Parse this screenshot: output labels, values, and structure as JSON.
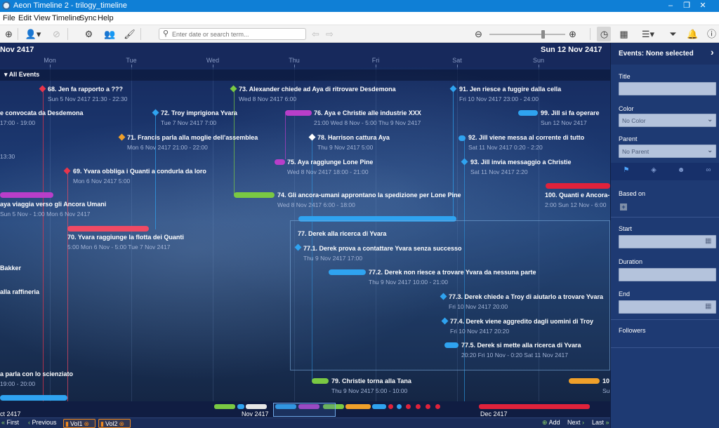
{
  "window": {
    "title": "Aeon Timeline 2 - trilogy_timeline",
    "controls": [
      "–",
      "❐",
      "✕"
    ]
  },
  "menu": [
    "File",
    "Edit",
    "View",
    "Timeline",
    "Sync",
    "Help"
  ],
  "search": {
    "placeholder": "Enter date or search term..."
  },
  "timeline": {
    "date_left": "Nov 2417",
    "date_right": "Sun 12 Nov 2417",
    "days": [
      "Mon",
      "Tue",
      "Wed",
      "Thu",
      "Fri",
      "Sat",
      "Sun"
    ],
    "all_events_label": "All Events",
    "events": [
      {
        "title": "68. Jen fa rapporto a ???",
        "date": "Sun 5 Nov 2417 21:30 - 22:30",
        "color": "#e8354b"
      },
      {
        "title": "e convocata da Desdemona",
        "date": "17:00 - 19:00",
        "color": "#d33aa3"
      },
      {
        "title": "13:30",
        "date": "",
        "color": "#ffffff"
      },
      {
        "title": "69. Yvara obbliga i Quanti a condurla da loro",
        "date": "Mon 6 Nov 2417 5:00",
        "color": "#e8354b"
      },
      {
        "title": "aya viaggia verso gli Ancora Umani",
        "date": "Sun 5 Nov - 1:00 Mon 6 Nov 2417",
        "color": "#b83ec9"
      },
      {
        "title": "70. Yvara raggiunge la flotta dei Quanti",
        "date": "5:00 Mon 6 Nov - 5:00 Tue 7 Nov 2417",
        "color": "#f04a64"
      },
      {
        "title": "Bakker",
        "date": "",
        "color": "#ffffff"
      },
      {
        "title": "alla raffineria",
        "date": "",
        "color": "#ffffff"
      },
      {
        "title": "a parla con lo scienziato",
        "date": "19:00 - 20:00",
        "color": "#ffffff"
      },
      {
        "title": "71. Francis parla alla moglie dell'assemblea",
        "date": "Mon 6 Nov 2417 21:00 - 22:00",
        "color": "#f0a02a"
      },
      {
        "title": "72. Troy imprigiona Yvara",
        "date": "Tue 7 Nov 2417 7:00",
        "color": "#2fa3f0"
      },
      {
        "title": "73. Alexander chiede ad Aya di ritrovare Desdemona",
        "date": "Wed 8 Nov 2417 6:00",
        "color": "#7ac943"
      },
      {
        "title": "74. Gli ancora-umani approntano la spedizione per Lone Pine",
        "date": "Wed 8 Nov 2417 6:00 - 18:00",
        "color": "#7ac943"
      },
      {
        "title": "75. Aya raggiunge Lone Pine",
        "date": "Wed 8 Nov 2417 18:00 - 21:00",
        "color": "#b83ec9"
      },
      {
        "title": "76. Aya e Christie alle industrie XXX",
        "date": "21:00 Wed 8 Nov - 5:00 Thu 9 Nov 2417",
        "color": "#b83ec9"
      },
      {
        "title": "78. Harrison cattura Aya",
        "date": "Thu 9 Nov 2417 5:00",
        "color": "#ffffff"
      },
      {
        "title": "77. Derek alla ricerca di Yvara",
        "date": "",
        "color": "#2fa3f0"
      },
      {
        "title": "77.1. Derek prova a contattare Yvara senza successo",
        "date": "Thu 9 Nov 2417 17:00",
        "color": "#2fa3f0"
      },
      {
        "title": "77.2. Derek non riesce a trovare Yvara da nessuna parte",
        "date": "Thu 9 Nov 2417 10:00 - 21:00",
        "color": "#2fa3f0"
      },
      {
        "title": "77.3. Derek chiede a Troy di aiutarlo a trovare Yvara",
        "date": "Fri 10 Nov 2417 20:00",
        "color": "#2fa3f0"
      },
      {
        "title": "77.4. Derek viene aggredito dagli uomini di Troy",
        "date": "Fri 10 Nov 2417 20:20",
        "color": "#2fa3f0"
      },
      {
        "title": "77.5. Derek si mette alla ricerca di Yvara",
        "date": "20:20 Fri 10 Nov - 0:20 Sat 11 Nov 2417",
        "color": "#2fa3f0"
      },
      {
        "title": "79. Christie torna alla Tana",
        "date": "Thu 9 Nov 2417 5:00 - 10:00",
        "color": "#7ac943"
      },
      {
        "title": "91. Jen riesce a fuggire dalla cella",
        "date": "Fri 10 Nov 2417 23:00 - 24:00",
        "color": "#2fa3f0"
      },
      {
        "title": "92. Jill viene messa al corrente di tutto",
        "date": "Sat 11 Nov 2417 0:20 - 2:20",
        "color": "#2fa3f0"
      },
      {
        "title": "93. Jill invia messaggio a Christie",
        "date": "Sat 11 Nov 2417 2:20",
        "color": "#2fa3f0"
      },
      {
        "title": "99. Jill si fa operare",
        "date": "Sun 12 Nov 2417",
        "color": "#2fa3f0"
      },
      {
        "title": "100. Quanti e Ancora-",
        "date": "2:00 Sun 12 Nov - 6:00",
        "color": "#e0223b"
      },
      {
        "title": "10",
        "date": "Su",
        "color": "#f0a02a"
      }
    ],
    "overview_labels": [
      "ct 2417",
      "Nov 2417",
      "Dec 2417"
    ]
  },
  "navbar": {
    "first": "First",
    "previous": "Previous",
    "tabs": [
      "Vol1",
      "Vol2"
    ],
    "add": "Add",
    "next": "Next",
    "last": "Last"
  },
  "sidepanel": {
    "header": "Events: None selected",
    "title_label": "Title",
    "color_label": "Color",
    "color_value": "No Color",
    "parent_label": "Parent",
    "parent_value": "No Parent",
    "based_on_label": "Based on",
    "start_label": "Start",
    "duration_label": "Duration",
    "end_label": "End",
    "followers_label": "Followers",
    "tab_icons": [
      "flag-icon",
      "tag-icon",
      "people-icon",
      "link-icon"
    ]
  }
}
